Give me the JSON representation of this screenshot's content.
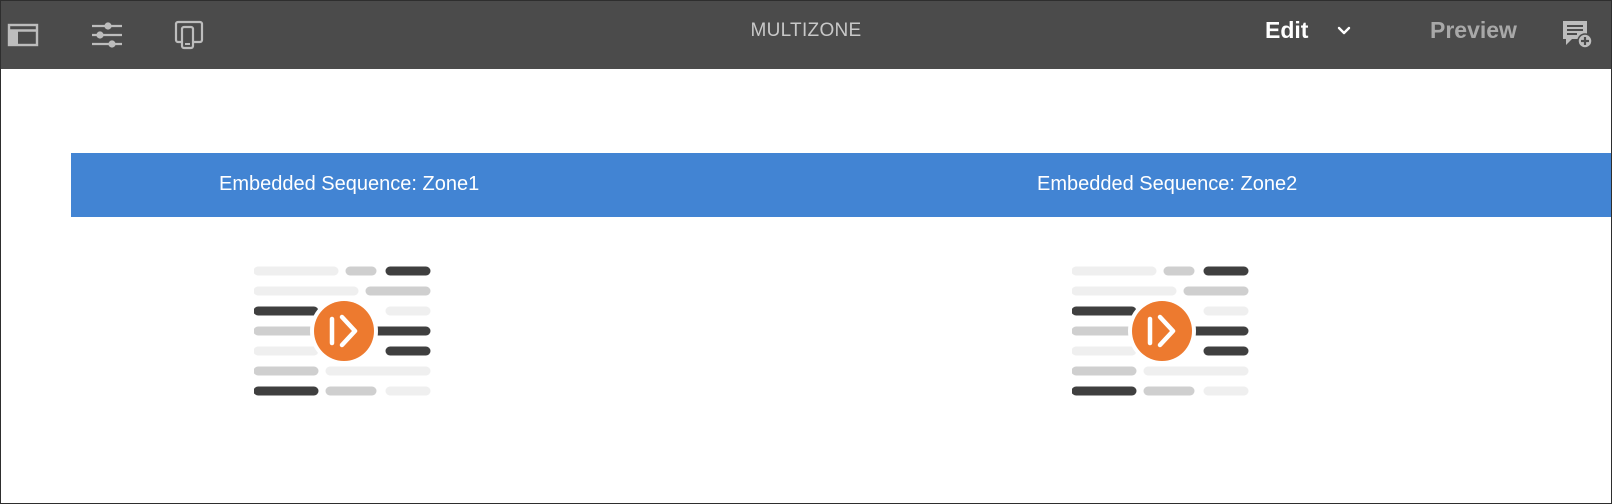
{
  "toolbar": {
    "title": "MULTIZONE",
    "mode_label": "Edit",
    "preview_label": "Preview",
    "icons": [
      "side-panel-icon",
      "properties-sliders-icon",
      "device-emulator-icon",
      "annotations-icon",
      "chevron-down-icon"
    ]
  },
  "zones": [
    {
      "label": "Embedded Sequence: Zone1",
      "icon": "embedded-sequence-placeholder-icon"
    },
    {
      "label": "Embedded Sequence: Zone2",
      "icon": "embedded-sequence-placeholder-icon"
    }
  ],
  "colors": {
    "toolbar_bg": "#4b4b4b",
    "zone_bar": "#4284d3",
    "play_accent": "#ed7a2f"
  }
}
